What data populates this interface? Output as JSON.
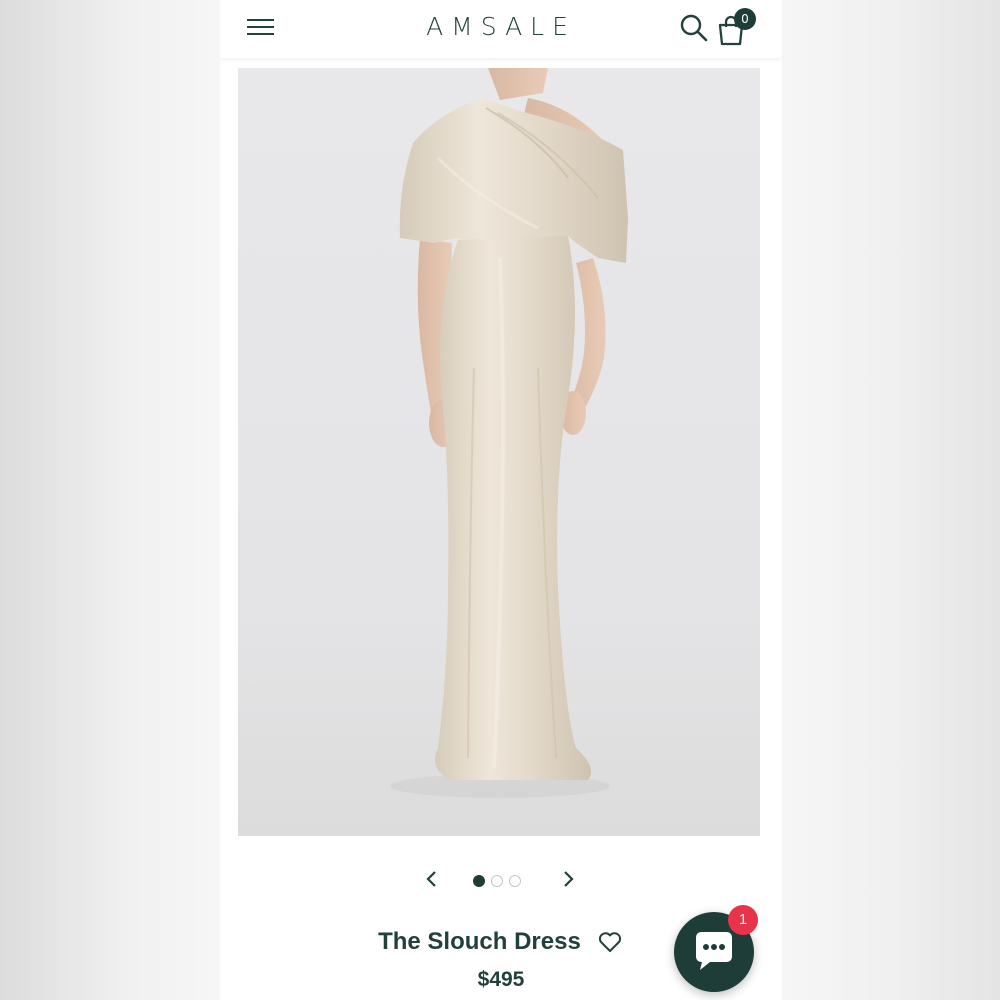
{
  "header": {
    "logo_text": "AMSALE",
    "cart_count": "0"
  },
  "product": {
    "title": "The Slouch Dress",
    "price": "$495",
    "image_index": 1,
    "image_count": 3
  },
  "chat": {
    "badge_count": "1"
  },
  "colors": {
    "brand": "#1f3d38",
    "badge": "#e8334a",
    "dress": "#e2d8c8"
  },
  "icons": {
    "menu": "hamburger-icon",
    "search": "search-icon",
    "cart": "shopping-bag-icon",
    "prev": "chevron-left-icon",
    "next": "chevron-right-icon",
    "wishlist": "heart-icon",
    "chat": "chat-bubble-icon"
  }
}
